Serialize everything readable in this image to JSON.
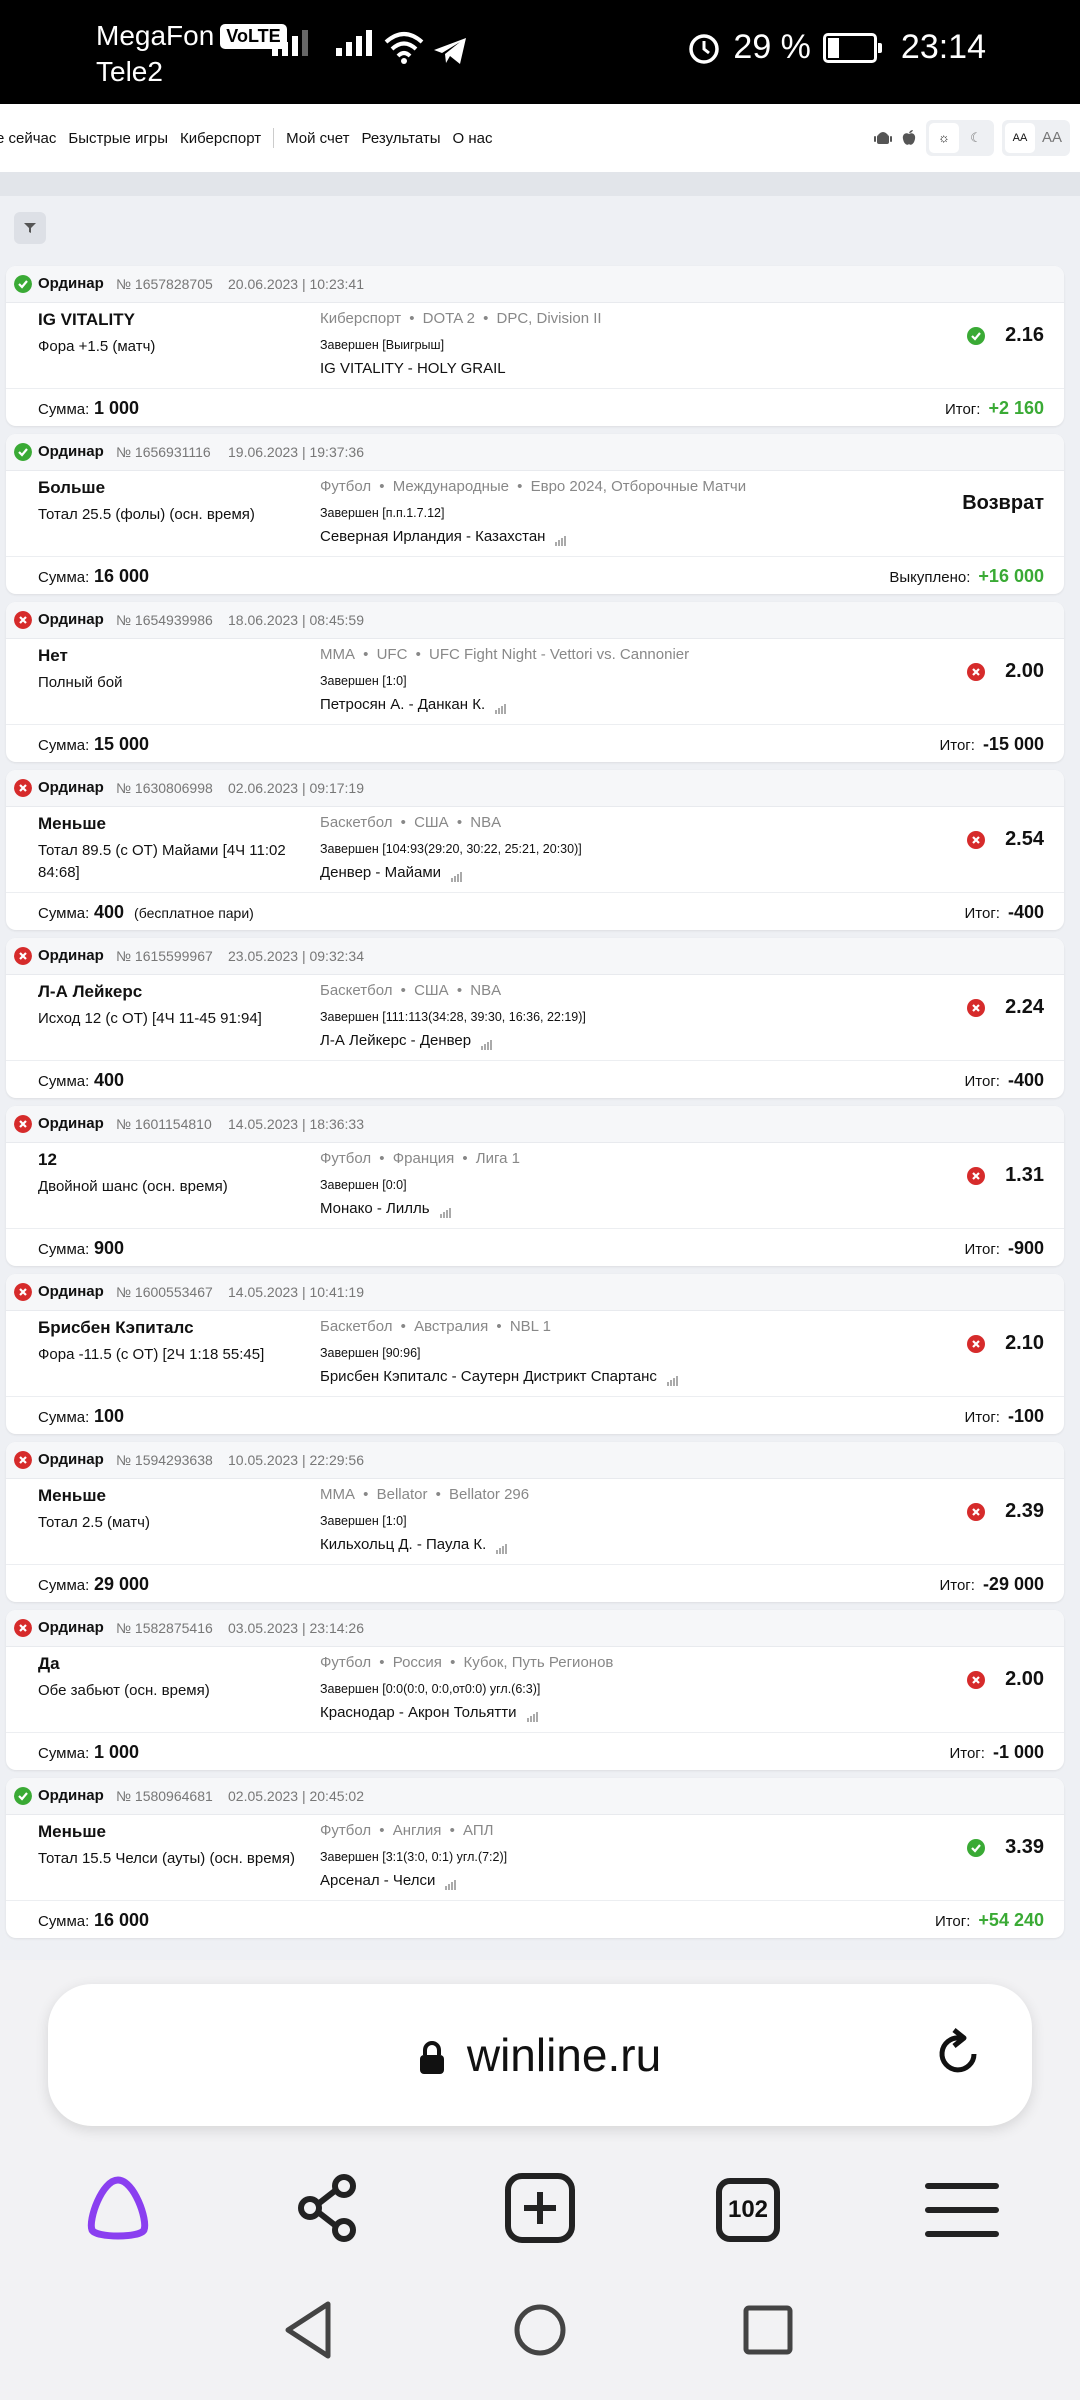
{
  "status_bar": {
    "carrier1": "MegaFon",
    "volte": "VoLTE",
    "carrier2": "Tele2",
    "battery": "29 %",
    "time": "23:14"
  },
  "nav": {
    "links": [
      "е сейчас",
      "Быстрые игры",
      "Киберспорт"
    ],
    "links2": [
      "Мой счет",
      "Результаты",
      "О нас"
    ],
    "font_small": "AA",
    "font_large": "AA"
  },
  "bets": [
    {
      "status": "win",
      "type": "Ординар",
      "num": "№ 1657828705",
      "date": "20.06.2023 | 10:23:41",
      "selection": "IG VITALITY",
      "market": "Фора +1.5 (матч)",
      "crumb": [
        "Киберспорт",
        "DOTA 2",
        "DPC, Division II"
      ],
      "state": "Завершен [Выигрыш]",
      "teams": "IG VITALITY - HOLY GRAIL",
      "stats": false,
      "odds": "2.16",
      "sum_label": "Сумма:",
      "sum": "1 000",
      "note": "",
      "result_label": "Итог:",
      "result": "+2 160"
    },
    {
      "status": "win",
      "type": "Ординар",
      "num": "№ 1656931116",
      "date": "19.06.2023 | 19:37:36",
      "selection": "Больше",
      "market": "Тотал 25.5 (фолы) (осн. время)",
      "crumb": [
        "Футбол",
        "Международные",
        "Евро 2024, Отборочные Матчи"
      ],
      "state": "Завершен [п.п.1.7.12]",
      "teams": "Северная Ирландия - Казахстан",
      "stats": true,
      "odds": "",
      "return": "Возврат",
      "sum_label": "Сумма:",
      "sum": "16 000",
      "note": "",
      "result_label": "Выкуплено:",
      "result": "+16 000"
    },
    {
      "status": "loss",
      "type": "Ординар",
      "num": "№ 1654939986",
      "date": "18.06.2023 | 08:45:59",
      "selection": "Нет",
      "market": "Полный бой",
      "crumb": [
        "MMA",
        "UFC",
        "UFC Fight Night - Vettori vs. Cannonier"
      ],
      "state": "Завершен [1:0]",
      "teams": "Петросян А. - Данкан К.",
      "stats": true,
      "odds": "2.00",
      "sum_label": "Сумма:",
      "sum": "15 000",
      "note": "",
      "result_label": "Итог:",
      "result": "-15 000"
    },
    {
      "status": "loss",
      "type": "Ординар",
      "num": "№ 1630806998",
      "date": "02.06.2023 | 09:17:19",
      "selection": "Меньше",
      "market": "Тотал 89.5 (с ОТ) Майами [4Ч 11:02 84:68]",
      "crumb": [
        "Баскетбол",
        "США",
        "NBA"
      ],
      "state": "Завершен [104:93(29:20, 30:22, 25:21, 20:30)]",
      "teams": "Денвер - Майами",
      "stats": true,
      "odds": "2.54",
      "sum_label": "Сумма:",
      "sum": "400",
      "note": "(бесплатное пари)",
      "result_label": "Итог:",
      "result": "-400"
    },
    {
      "status": "loss",
      "type": "Ординар",
      "num": "№ 1615599967",
      "date": "23.05.2023 | 09:32:34",
      "selection": "Л-А Лейкерс",
      "market": "Исход 12 (с ОТ) [4Ч 11-45 91:94]",
      "crumb": [
        "Баскетбол",
        "США",
        "NBA"
      ],
      "state": "Завершен [111:113(34:28, 39:30, 16:36, 22:19)]",
      "teams": "Л-А Лейкерс - Денвер",
      "stats": true,
      "odds": "2.24",
      "sum_label": "Сумма:",
      "sum": "400",
      "note": "",
      "result_label": "Итог:",
      "result": "-400"
    },
    {
      "status": "loss",
      "type": "Ординар",
      "num": "№ 1601154810",
      "date": "14.05.2023 | 18:36:33",
      "selection": "12",
      "market": "Двойной шанс (осн. время)",
      "crumb": [
        "Футбол",
        "Франция",
        "Лига 1"
      ],
      "state": "Завершен [0:0]",
      "teams": "Монако - Лилль",
      "stats": true,
      "odds": "1.31",
      "sum_label": "Сумма:",
      "sum": "900",
      "note": "",
      "result_label": "Итог:",
      "result": "-900"
    },
    {
      "status": "loss",
      "type": "Ординар",
      "num": "№ 1600553467",
      "date": "14.05.2023 | 10:41:19",
      "selection": "Брисбен Кэпиталс",
      "market": "Фора -11.5 (с ОТ) [2Ч 1:18 55:45]",
      "crumb": [
        "Баскетбол",
        "Австралия",
        "NBL 1"
      ],
      "state": "Завершен [90:96]",
      "teams": "Брисбен Кэпиталс - Саутерн Дистрикт Спартанс",
      "stats": true,
      "odds": "2.10",
      "sum_label": "Сумма:",
      "sum": "100",
      "note": "",
      "result_label": "Итог:",
      "result": "-100"
    },
    {
      "status": "loss",
      "type": "Ординар",
      "num": "№ 1594293638",
      "date": "10.05.2023 | 22:29:56",
      "selection": "Меньше",
      "market": "Тотал 2.5 (матч)",
      "crumb": [
        "MMA",
        "Bellator",
        "Bellator 296"
      ],
      "state": "Завершен [1:0]",
      "teams": "Кильхольц Д. - Паула К.",
      "stats": true,
      "odds": "2.39",
      "sum_label": "Сумма:",
      "sum": "29 000",
      "note": "",
      "result_label": "Итог:",
      "result": "-29 000"
    },
    {
      "status": "loss",
      "type": "Ординар",
      "num": "№ 1582875416",
      "date": "03.05.2023 | 23:14:26",
      "selection": "Да",
      "market": "Обе забьют (осн. время)",
      "crumb": [
        "Футбол",
        "Россия",
        "Кубок, Путь Регионов"
      ],
      "state": "Завершен [0:0(0:0, 0:0,от0:0) угл.(6:3)]",
      "teams": "Краснодар - Акрон Тольятти",
      "stats": true,
      "odds": "2.00",
      "sum_label": "Сумма:",
      "sum": "1 000",
      "note": "",
      "result_label": "Итог:",
      "result": "-1 000"
    },
    {
      "status": "win",
      "type": "Ординар",
      "num": "№ 1580964681",
      "date": "02.05.2023 | 20:45:02",
      "selection": "Меньше",
      "market": "Тотал 15.5 Челси (ауты) (осн. время)",
      "crumb": [
        "Футбол",
        "Англия",
        "АПЛ"
      ],
      "state": "Завершен [3:1(3:0, 0:1) угл.(7:2)]",
      "teams": "Арсенал - Челси",
      "stats": true,
      "odds": "3.39",
      "sum_label": "Сумма:",
      "sum": "16 000",
      "note": "",
      "result_label": "Итог:",
      "result": "+54 240"
    }
  ],
  "colors": {
    "win": "#3aaa35",
    "loss": "#d62b2b",
    "accent": "#7b3fe4"
  },
  "browser": {
    "url": "winline.ru",
    "tabs_count": "102"
  }
}
